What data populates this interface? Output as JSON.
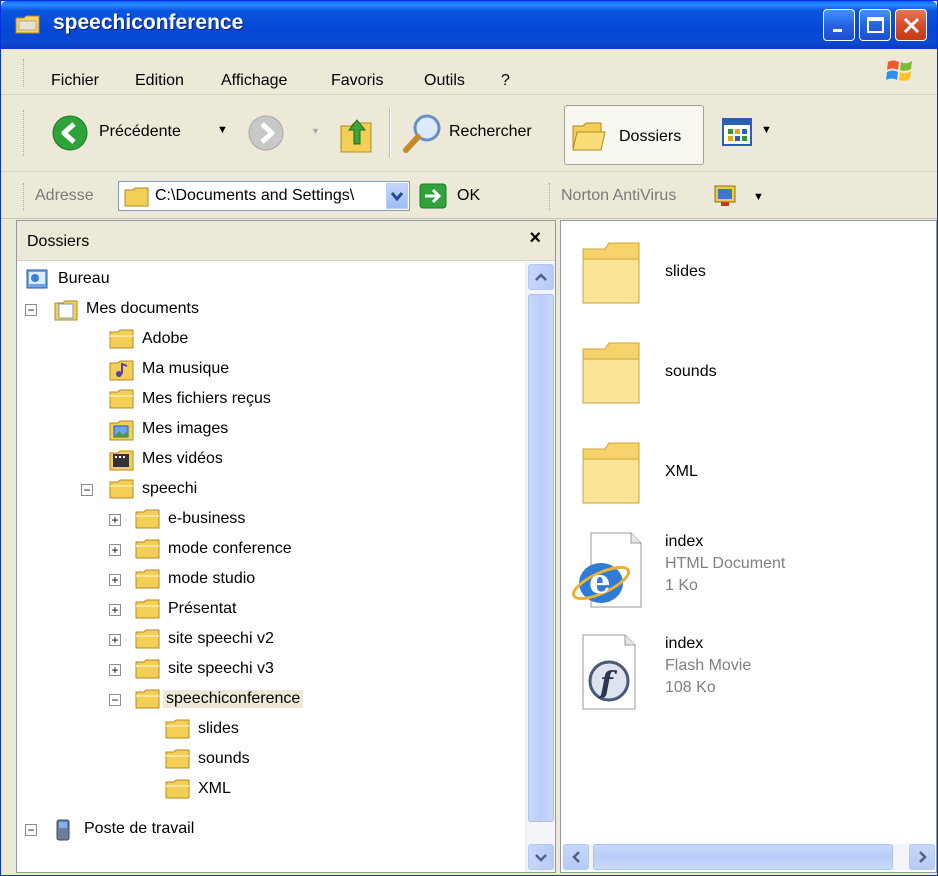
{
  "window": {
    "title": "speechiconference",
    "accent": "#0a55e0",
    "close_color": "#d44a26"
  },
  "menu": {
    "items": [
      "Fichier",
      "Edition",
      "Affichage",
      "Favoris",
      "Outils",
      "?"
    ]
  },
  "toolbar": {
    "back_label": "Précédente",
    "search_label": "Rechercher",
    "folders_label": "Dossiers",
    "icons": [
      "back-arrow-icon",
      "forward-arrow-icon",
      "up-folder-icon",
      "search-magnifier-icon",
      "folders-icon",
      "views-icon"
    ]
  },
  "address": {
    "label": "Adresse",
    "value": "C:\\Documents and Settings\\",
    "go_label": "OK",
    "norton_label": "Norton AntiVirus"
  },
  "folders_panel": {
    "title": "Dossiers",
    "close_glyph": "×",
    "tree": [
      {
        "label": "Bureau",
        "expander": "",
        "icon": "desktop-icon"
      },
      {
        "label": "Mes documents",
        "expander": "−",
        "icon": "my-documents-icon"
      },
      {
        "label": "Adobe",
        "expander": "",
        "icon": "folder-icon"
      },
      {
        "label": "Ma musique",
        "expander": "",
        "icon": "music-folder-icon"
      },
      {
        "label": "Mes fichiers reçus",
        "expander": "",
        "icon": "folder-icon"
      },
      {
        "label": "Mes images",
        "expander": "",
        "icon": "pictures-folder-icon"
      },
      {
        "label": "Mes vidéos",
        "expander": "",
        "icon": "videos-folder-icon"
      },
      {
        "label": "speechi",
        "expander": "−",
        "icon": "folder-icon"
      },
      {
        "label": "e-business",
        "expander": "+",
        "icon": "folder-icon"
      },
      {
        "label": "mode conference",
        "expander": "+",
        "icon": "folder-icon"
      },
      {
        "label": "mode studio",
        "expander": "+",
        "icon": "folder-icon"
      },
      {
        "label": "Présentat",
        "expander": "+",
        "icon": "folder-icon"
      },
      {
        "label": "site speechi v2",
        "expander": "+",
        "icon": "folder-icon"
      },
      {
        "label": "site speechi v3",
        "expander": "+",
        "icon": "folder-icon"
      },
      {
        "label": "speechiconference",
        "expander": "−",
        "icon": "folder-icon",
        "selected": true
      },
      {
        "label": "slides",
        "expander": "",
        "icon": "folder-icon"
      },
      {
        "label": "sounds",
        "expander": "",
        "icon": "folder-icon"
      },
      {
        "label": "XML",
        "expander": "",
        "icon": "folder-icon"
      },
      {
        "label": "Poste de travail",
        "expander": "−",
        "icon": "my-computer-icon"
      }
    ]
  },
  "files": [
    {
      "name": "slides",
      "type": "",
      "size": "",
      "icon": "large-folder-icon"
    },
    {
      "name": "sounds",
      "type": "",
      "size": "",
      "icon": "large-folder-icon"
    },
    {
      "name": "XML",
      "type": "",
      "size": "",
      "icon": "large-folder-icon"
    },
    {
      "name": "index",
      "type": "HTML Document",
      "size": "1 Ko",
      "icon": "html-document-icon"
    },
    {
      "name": "index",
      "type": "Flash Movie",
      "size": "108 Ko",
      "icon": "flash-movie-icon"
    }
  ]
}
